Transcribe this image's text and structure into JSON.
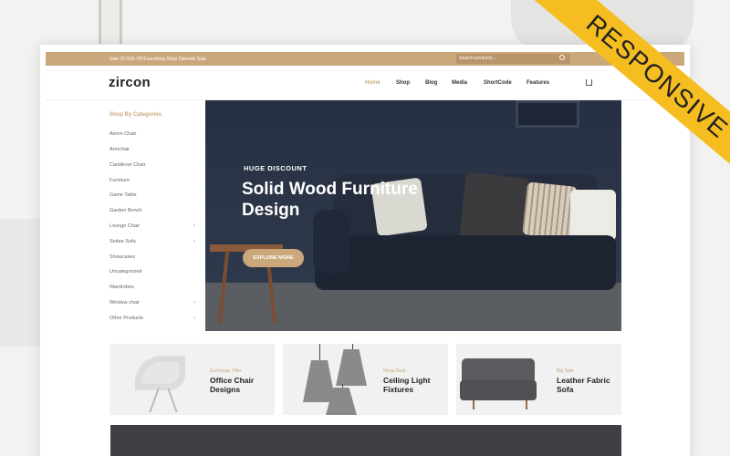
{
  "topbar": {
    "promo": "Sale Of 50% Off Everything Shop Sitewide Sale",
    "search_placeholder": "Search products..."
  },
  "header": {
    "logo": "zircon",
    "nav": [
      "Home",
      "Shop",
      "Blog",
      "Media",
      "ShortCode",
      "Features"
    ],
    "active_nav": "Home"
  },
  "sidebar": {
    "title": "Shop By Categories",
    "categories": [
      {
        "label": "Aeron Chair",
        "has_arrow": false
      },
      {
        "label": "Armchair",
        "has_arrow": false
      },
      {
        "label": "Cantilever Chair",
        "has_arrow": false
      },
      {
        "label": "Furniture",
        "has_arrow": false
      },
      {
        "label": "Game Table",
        "has_arrow": false
      },
      {
        "label": "Garden Bench",
        "has_arrow": false
      },
      {
        "label": "Lounge Chair",
        "has_arrow": true
      },
      {
        "label": "Settee Sofa",
        "has_arrow": true
      },
      {
        "label": "Showcases",
        "has_arrow": false
      },
      {
        "label": "Uncategorized",
        "has_arrow": false
      },
      {
        "label": "Wardrobes",
        "has_arrow": false
      },
      {
        "label": "Window chair",
        "has_arrow": true
      },
      {
        "label": "Other Products",
        "has_arrow": true
      }
    ]
  },
  "hero": {
    "eyebrow": "HUGE DISCOUNT",
    "title": "Solid Wood Furniture Design",
    "button": "EXPLORE MORE"
  },
  "banners": [
    {
      "kicker": "Exchange Offer",
      "title": "Office Chair Designs"
    },
    {
      "kicker": "Mega Deal",
      "title": "Ceiling Light Fixtures"
    },
    {
      "kicker": "Big Sale",
      "title": "Leather Fabric Sofa"
    }
  ],
  "ribbon": "RESPONSIVE",
  "colors": {
    "accent": "#cba77c",
    "ribbon": "#f5bd1f",
    "hero_bg": "#2b3345"
  },
  "icons": [
    "search-icon",
    "cart-icon",
    "chevron-right-icon"
  ]
}
